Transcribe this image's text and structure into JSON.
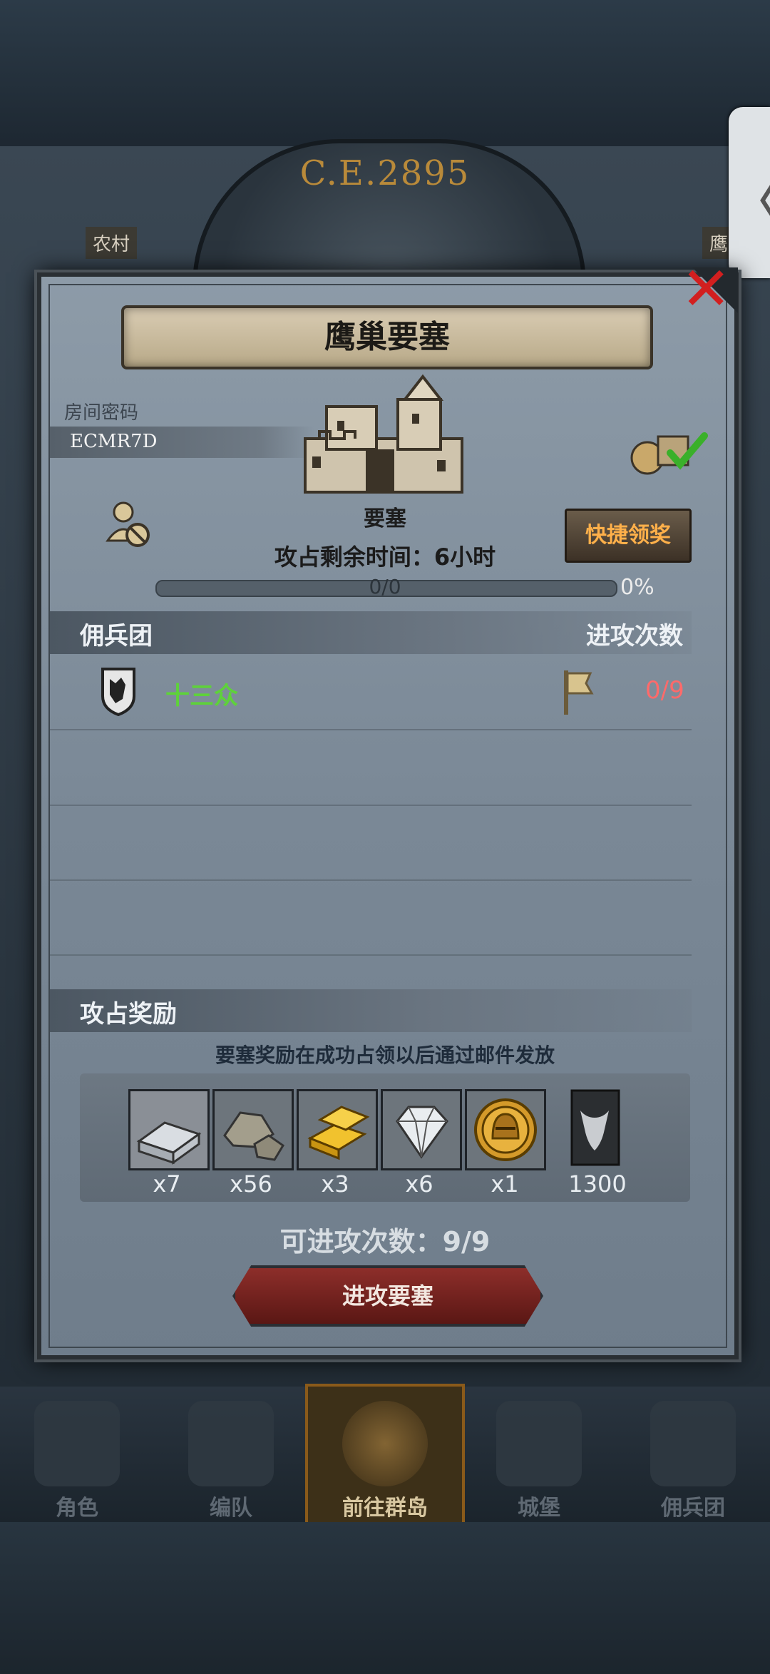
{
  "header": {
    "era": "C.E.2895",
    "side_label_left": "农村",
    "side_label_right": "鹰",
    "side_tab_glyph": "〈"
  },
  "modal": {
    "title": "鹰巢要塞",
    "room_label": "房间密码",
    "room_code": "ECMR7D",
    "fortress_name": "要塞",
    "time_remaining": "攻占剩余时间：6小时",
    "progress_text": "0/0",
    "progress_percent": "0%",
    "progress_value": 0,
    "quick_claim_button": "快捷领奖",
    "mercenary_header": "佣兵团",
    "attack_count_header": "进攻次数",
    "mercenaries": [
      {
        "name": "十三众",
        "attacks": "0/9"
      }
    ],
    "reward_header": "攻占奖励",
    "reward_note": "要塞奖励在成功占领以后通过邮件发放",
    "rewards": [
      {
        "icon": "silver-ingot-icon",
        "qty": "x7"
      },
      {
        "icon": "stone-ore-icon",
        "qty": "x56"
      },
      {
        "icon": "gold-bars-icon",
        "qty": "x3"
      },
      {
        "icon": "diamond-icon",
        "qty": "x6"
      },
      {
        "icon": "gold-helmet-coin-icon",
        "qty": "x1"
      },
      {
        "icon": "bull-banner-icon",
        "qty": "1300"
      }
    ],
    "attempts_left": "可进攻次数：9/9",
    "attack_button": "进攻要塞"
  },
  "nav": [
    {
      "label": "角色",
      "active": false
    },
    {
      "label": "编队",
      "active": false
    },
    {
      "label": "前往群岛",
      "active": true
    },
    {
      "label": "城堡",
      "active": false
    },
    {
      "label": "佣兵团",
      "active": false
    }
  ],
  "colors": {
    "accent_green": "#5ed23a",
    "count_red": "#ff6a6a",
    "quick_text": "#ffb04a",
    "close_red": "#d21f1f"
  }
}
